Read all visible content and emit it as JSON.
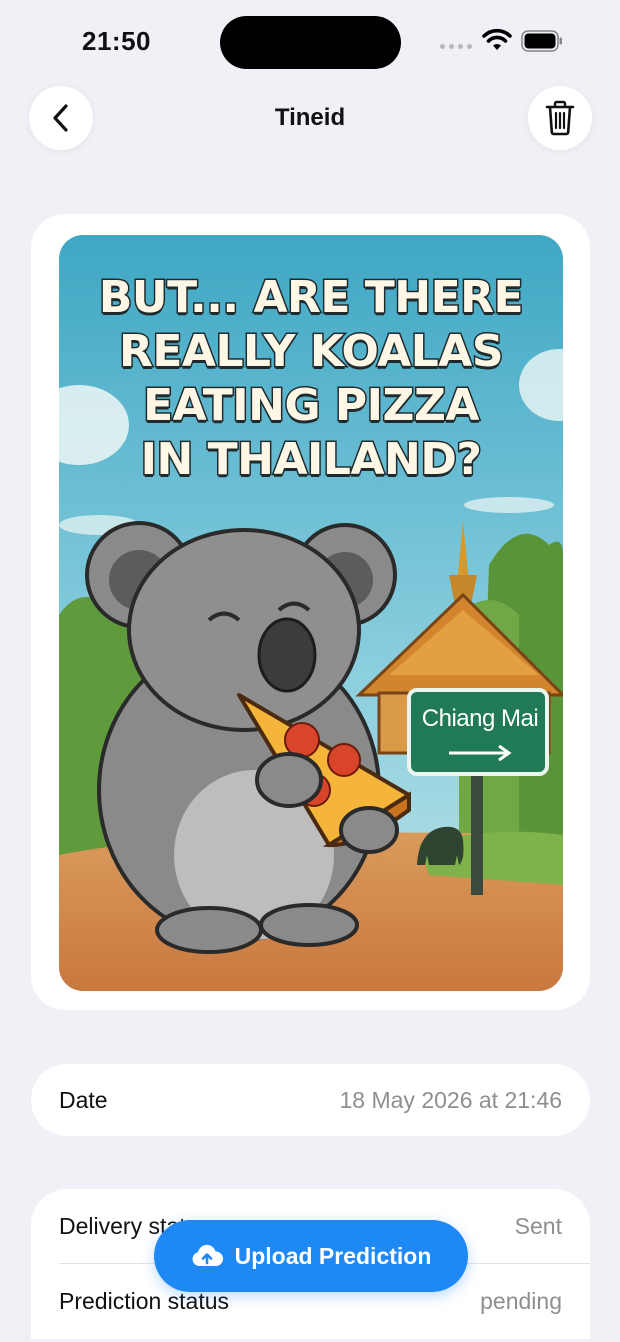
{
  "status_bar": {
    "time": "21:50"
  },
  "nav": {
    "title": "Tineid",
    "back_icon": "chevron-left-icon",
    "delete_icon": "trash-icon"
  },
  "poster": {
    "title_lines": [
      "BUT... ARE THERE",
      "REALLY KOALAS",
      "EATING PIZZA",
      "IN THAILAND?"
    ],
    "sign_text": "Chiang Mai"
  },
  "details": {
    "date_label": "Date",
    "date_value": "18 May 2026 at 21:46",
    "delivery_label": "Delivery status",
    "delivery_value": "Sent",
    "prediction_label": "Prediction status",
    "prediction_value": "pending"
  },
  "upload_button": {
    "label": "Upload Prediction",
    "icon": "cloud-upload-icon"
  },
  "colors": {
    "accent": "#1e88f5",
    "background": "#f0f0f6"
  }
}
